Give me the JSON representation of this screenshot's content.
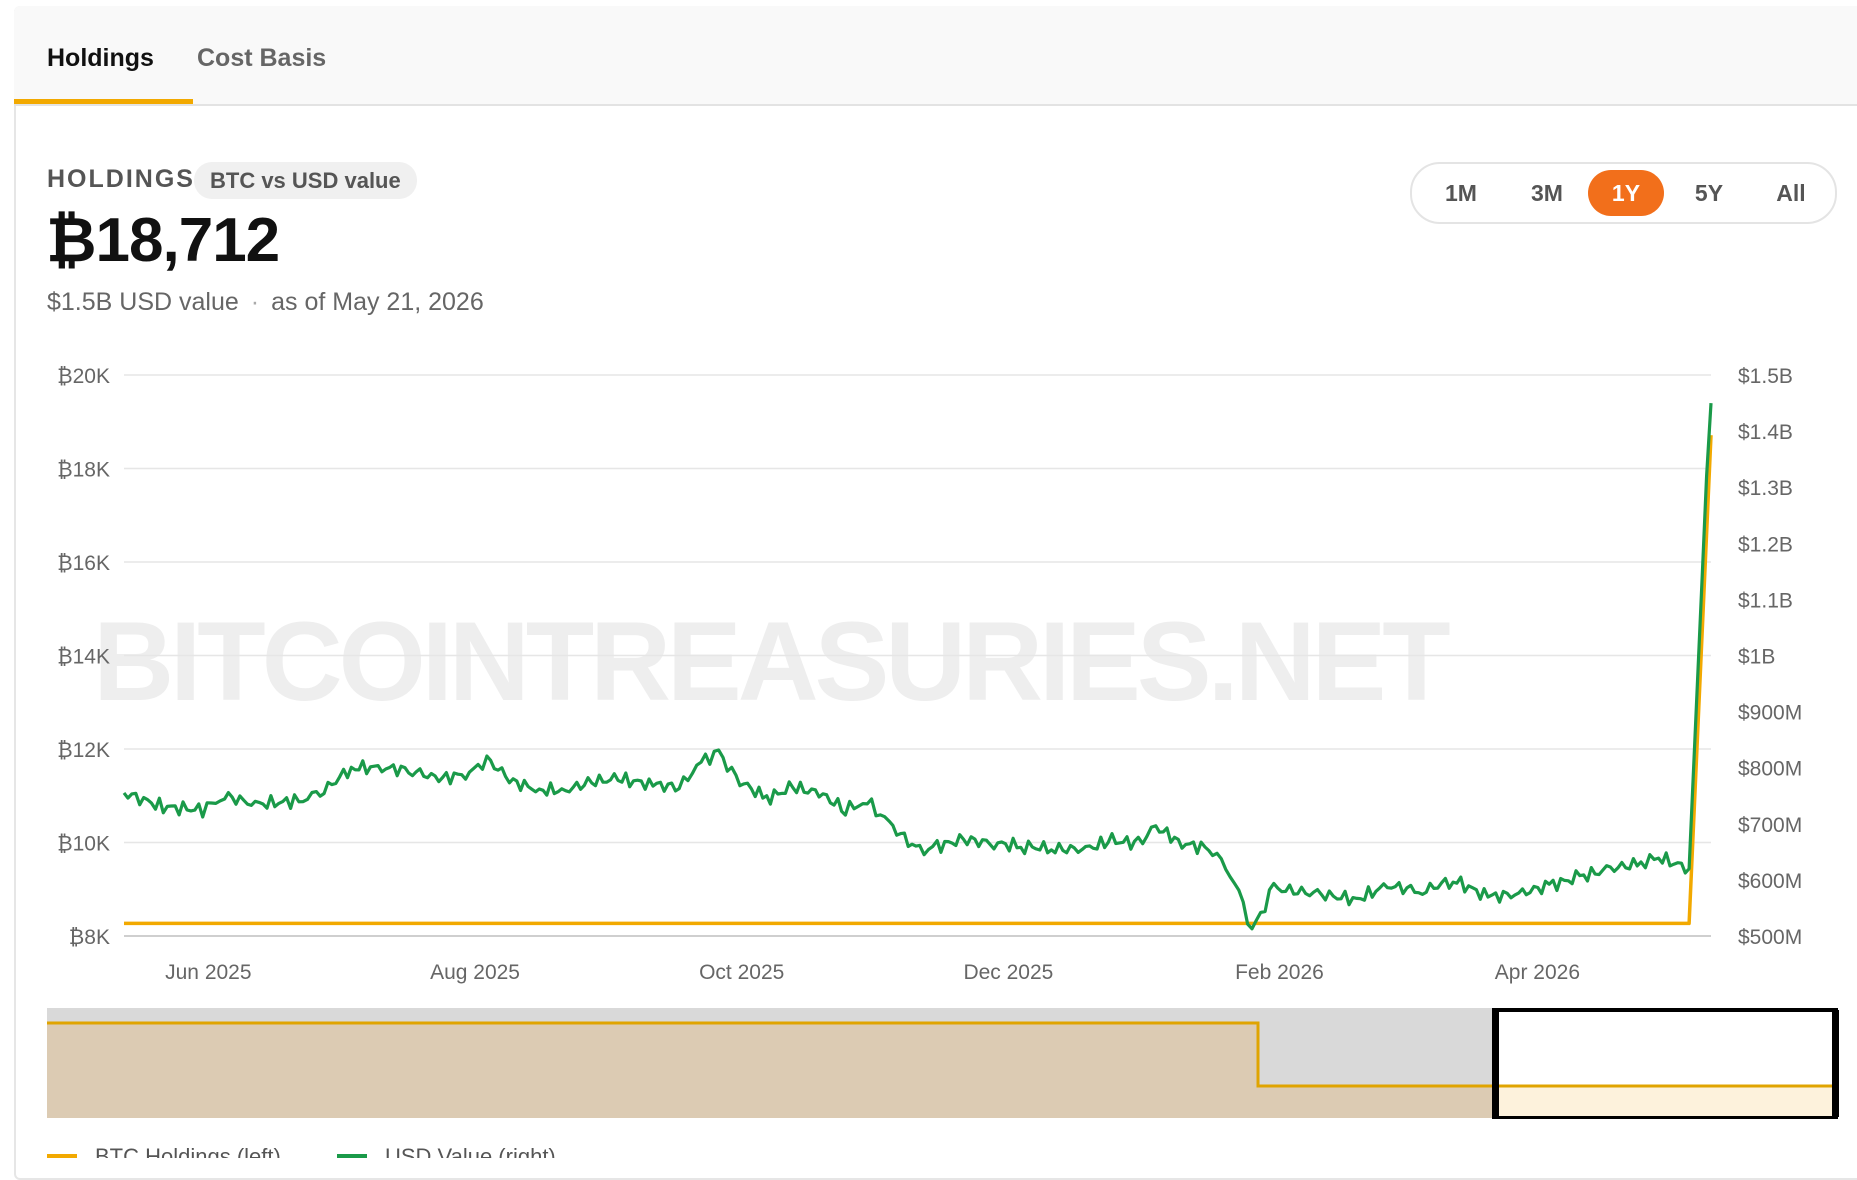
{
  "tabs": [
    {
      "label": "Holdings",
      "active": true
    },
    {
      "label": "Cost Basis",
      "active": false
    }
  ],
  "header": {
    "label": "HOLDINGS",
    "pill": "BTC vs USD value",
    "value": "₿18,712",
    "usd_value": "$1.5B USD value",
    "separator": "·",
    "as_of": "as of May 21, 2026"
  },
  "ranges": [
    {
      "label": "1M",
      "active": false
    },
    {
      "label": "3M",
      "active": false
    },
    {
      "label": "1Y",
      "active": true
    },
    {
      "label": "5Y",
      "active": false
    },
    {
      "label": "All",
      "active": false
    }
  ],
  "watermark": "BITCOINTREASURIES.NET",
  "legend": [
    {
      "label": "BTC Holdings (left)",
      "color": "#f2a900"
    },
    {
      "label": "USD Value (right)",
      "color": "#1a9a49"
    }
  ],
  "colors": {
    "accent": "#f2a900",
    "active_range": "#f26f1b",
    "usd_line": "#1a9a49",
    "btc_line": "#f2a900"
  },
  "chart_data": {
    "type": "line",
    "x_ticks": [
      "Jun 2025",
      "Aug 2025",
      "Oct 2025",
      "Dec 2025",
      "Feb 2026",
      "Apr 2026"
    ],
    "y_left_ticks": [
      "₿20K",
      "₿18K",
      "₿16K",
      "₿14K",
      "₿12K",
      "₿10K",
      "₿8K"
    ],
    "y_right_ticks": [
      "$1.5B",
      "$1.4B",
      "$1.3B",
      "$1.2B",
      "$1.1B",
      "$1B",
      "$900M",
      "$800M",
      "$700M",
      "$600M",
      "$500M"
    ],
    "y_left_range": [
      8000,
      20000
    ],
    "y_right_range": [
      500000000,
      1500000000
    ],
    "x_range": [
      "2025-05-23",
      "2026-05-21"
    ],
    "grid": true,
    "series": [
      {
        "name": "BTC Holdings (left)",
        "axis": "left",
        "points": [
          [
            "2025-05-23",
            8270
          ],
          [
            "2026-05-16",
            8270
          ],
          [
            "2026-05-21",
            18712
          ]
        ]
      },
      {
        "name": "USD Value (right)",
        "axis": "right",
        "points": [
          [
            "2025-05-23",
            755000000
          ],
          [
            "2025-06-01",
            730000000
          ],
          [
            "2025-06-10",
            725000000
          ],
          [
            "2025-06-15",
            750000000
          ],
          [
            "2025-06-22",
            735000000
          ],
          [
            "2025-07-01",
            740000000
          ],
          [
            "2025-07-06",
            748000000
          ],
          [
            "2025-07-14",
            800000000
          ],
          [
            "2025-07-21",
            800000000
          ],
          [
            "2025-07-28",
            795000000
          ],
          [
            "2025-08-03",
            780000000
          ],
          [
            "2025-08-10",
            790000000
          ],
          [
            "2025-08-14",
            815000000
          ],
          [
            "2025-08-20",
            775000000
          ],
          [
            "2025-08-26",
            760000000
          ],
          [
            "2025-09-01",
            760000000
          ],
          [
            "2025-09-07",
            775000000
          ],
          [
            "2025-09-13",
            780000000
          ],
          [
            "2025-09-21",
            770000000
          ],
          [
            "2025-09-27",
            765000000
          ],
          [
            "2025-10-02",
            810000000
          ],
          [
            "2025-10-06",
            828000000
          ],
          [
            "2025-10-10",
            780000000
          ],
          [
            "2025-10-17",
            745000000
          ],
          [
            "2025-10-23",
            765000000
          ],
          [
            "2025-10-29",
            755000000
          ],
          [
            "2025-11-04",
            725000000
          ],
          [
            "2025-11-09",
            740000000
          ],
          [
            "2025-11-14",
            700000000
          ],
          [
            "2025-11-21",
            650000000
          ],
          [
            "2025-11-25",
            660000000
          ],
          [
            "2025-12-01",
            672000000
          ],
          [
            "2025-12-08",
            665000000
          ],
          [
            "2025-12-15",
            660000000
          ],
          [
            "2025-12-22",
            655000000
          ],
          [
            "2025-12-29",
            655000000
          ],
          [
            "2026-01-04",
            670000000
          ],
          [
            "2026-01-10",
            665000000
          ],
          [
            "2026-01-14",
            695000000
          ],
          [
            "2026-01-20",
            665000000
          ],
          [
            "2026-01-27",
            655000000
          ],
          [
            "2026-02-01",
            600000000
          ],
          [
            "2026-02-05",
            510000000
          ],
          [
            "2026-02-10",
            585000000
          ],
          [
            "2026-02-20",
            575000000
          ],
          [
            "2026-03-01",
            565000000
          ],
          [
            "2026-03-08",
            590000000
          ],
          [
            "2026-03-16",
            580000000
          ],
          [
            "2026-03-23",
            600000000
          ],
          [
            "2026-03-31",
            570000000
          ],
          [
            "2026-04-07",
            575000000
          ],
          [
            "2026-04-14",
            590000000
          ],
          [
            "2026-04-21",
            605000000
          ],
          [
            "2026-04-28",
            620000000
          ],
          [
            "2026-05-05",
            630000000
          ],
          [
            "2026-05-09",
            640000000
          ],
          [
            "2026-05-16",
            620000000
          ],
          [
            "2026-05-20",
            1320000000
          ],
          [
            "2026-05-21",
            1450000000
          ]
        ]
      }
    ]
  }
}
